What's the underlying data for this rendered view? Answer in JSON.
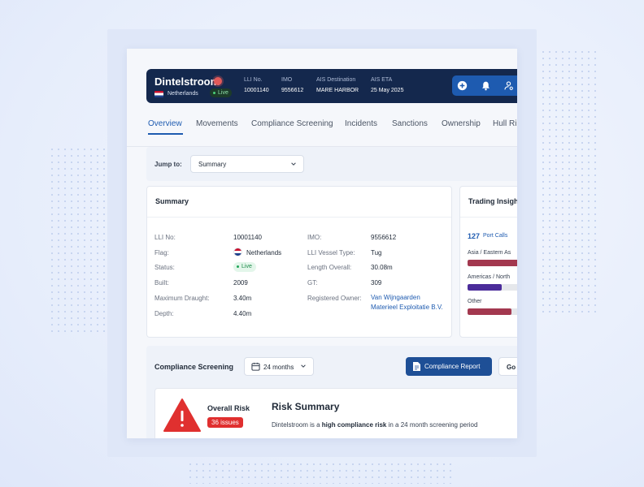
{
  "vessel": {
    "name": "Dintelstroom",
    "country": "Netherlands",
    "live_label": "Live",
    "meta": [
      {
        "label": "LLI No.",
        "value": "10001140"
      },
      {
        "label": "IMO",
        "value": "9556612"
      },
      {
        "label": "AIS Destination",
        "value": "MARE HARBOR"
      },
      {
        "label": "AIS ETA",
        "value": "25 May 2025"
      }
    ],
    "actions": [
      "plus-circle-icon",
      "bell-icon",
      "user-location-icon"
    ]
  },
  "tabs": [
    "Overview",
    "Movements",
    "Compliance Screening",
    "Incidents",
    "Sanctions",
    "Ownership",
    "Hull Ri"
  ],
  "jump": {
    "label": "Jump to:",
    "value": "Summary"
  },
  "summary": {
    "title": "Summary",
    "left": [
      {
        "label": "LLI No:",
        "value": "10001140"
      },
      {
        "label": "Flag:",
        "value": "Netherlands"
      },
      {
        "label": "Status:",
        "value": "Live"
      },
      {
        "label": "Built:",
        "value": "2009"
      },
      {
        "label": "Maximum Draught:",
        "value": "3.40m"
      },
      {
        "label": "Depth:",
        "value": "4.40m"
      }
    ],
    "right": [
      {
        "label": "IMO:",
        "value": "9556612"
      },
      {
        "label": "LLI Vessel Type:",
        "value": "Tug"
      },
      {
        "label": "Length Overall:",
        "value": "30.08m"
      },
      {
        "label": "GT:",
        "value": "309"
      },
      {
        "label": "Registered Owner:",
        "value_line1": "Van Wijngaarden",
        "value_line2": "Materieel Exploitatie B.V."
      }
    ]
  },
  "trading": {
    "title": "Trading Insigh",
    "port_calls_count": "127",
    "port_calls_label": "Port Calls",
    "regions": [
      {
        "name": "Asia / Eastern As",
        "fill": 0.55,
        "color": "#a3384f"
      },
      {
        "name": "Americas / North",
        "fill": 0.35,
        "color": "#4b2c9a"
      },
      {
        "name": "Other",
        "fill": 0.45,
        "color": "#a3384f"
      }
    ]
  },
  "compliance": {
    "title": "Compliance Screening",
    "period": "24 months",
    "report_button": "Compliance Report",
    "go_button": "Go",
    "overall_label": "Overall Risk",
    "issues": "36 issues",
    "risk_title": "Risk Summary",
    "risk_text_pre": "Dintelstroom is a ",
    "risk_text_bold": "high compliance risk",
    "risk_text_post": " in a 24 month screening period"
  },
  "colors": {
    "navy": "#14284d",
    "accent": "#1e5bb0",
    "danger": "#e02f2f"
  }
}
